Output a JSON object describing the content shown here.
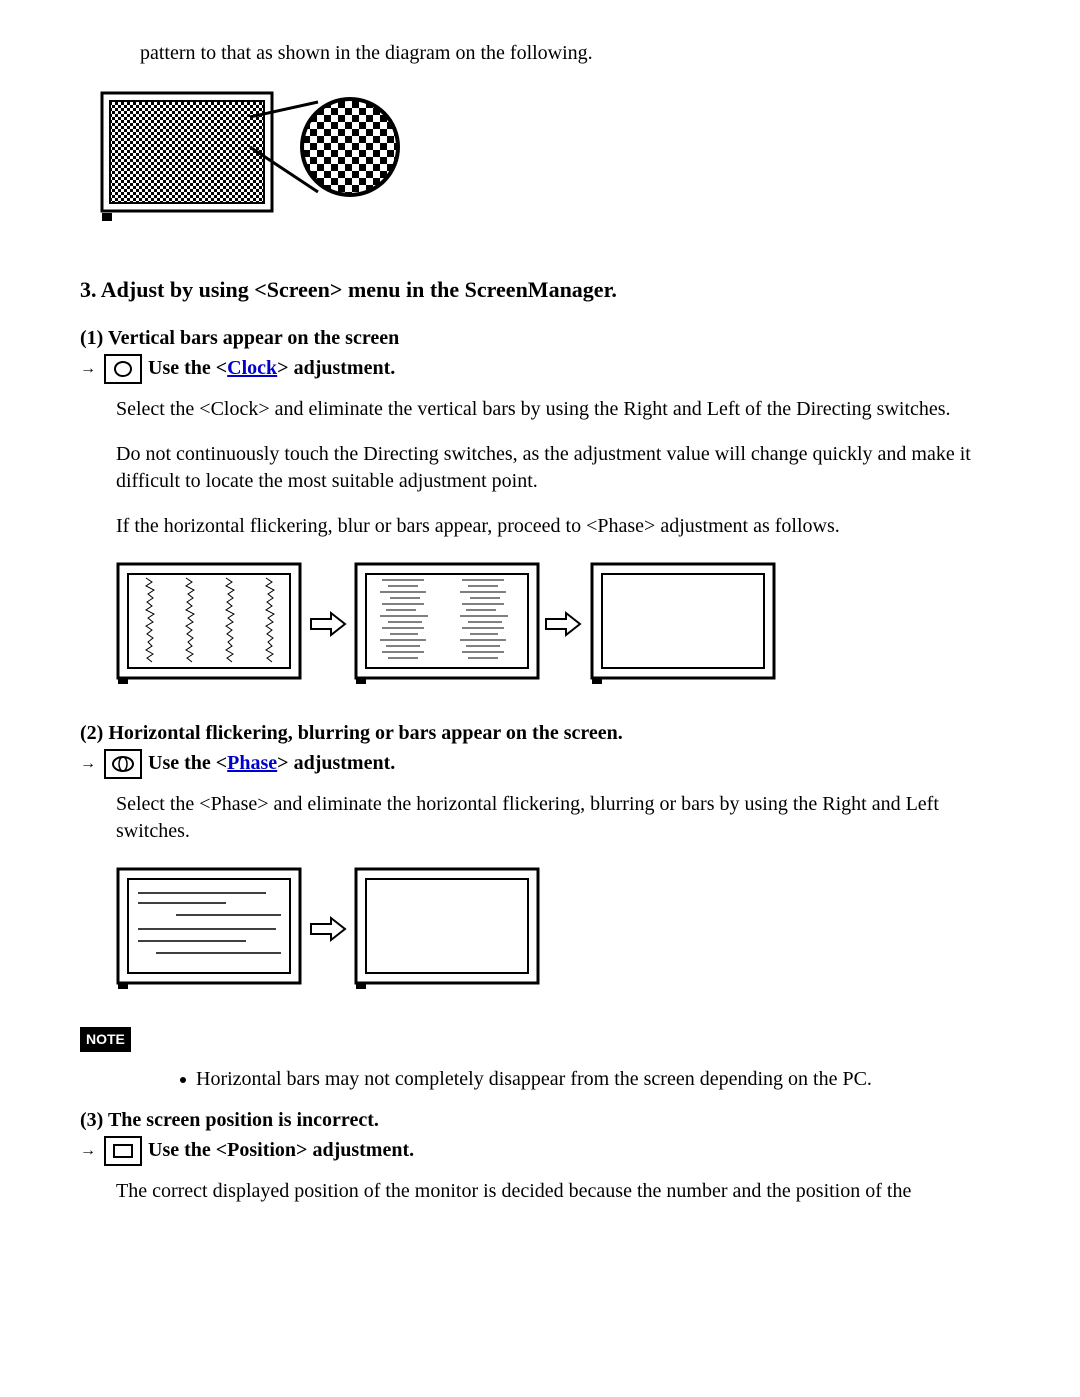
{
  "intro": "pattern to that as shown in the diagram on the following.",
  "section3_title": "3. Adjust by using <Screen> menu in the ScreenManager.",
  "step1": {
    "heading": "(1) Vertical bars appear on the screen",
    "prefix": "Use the <",
    "link": "Clock",
    "suffix": "> adjustment.",
    "para1": "Select the <Clock> and eliminate the vertical bars by using the Right and Left of the Directing switches.",
    "para2": "Do not continuously touch the Directing switches, as the adjustment value will change quickly and make it difficult to locate the most suitable adjustment point.",
    "para3": "If the horizontal flickering, blur or bars appear, proceed to <Phase> adjustment as follows."
  },
  "step2": {
    "heading": "(2) Horizontal flickering, blurring or bars appear on the screen.",
    "prefix": "Use the <",
    "link": "Phase",
    "suffix": "> adjustment.",
    "para1": "Select the <Phase> and eliminate the horizontal flickering, blurring or bars by using the Right and Left switches."
  },
  "note_label": "NOTE",
  "note_bullet": "Horizontal bars may not completely disappear from the screen depending on the PC.",
  "step3": {
    "heading": "(3) The screen position is incorrect.",
    "action": "Use the <Position> adjustment.",
    "para1": "The correct displayed position of the monitor is decided because the number and the position of the"
  }
}
